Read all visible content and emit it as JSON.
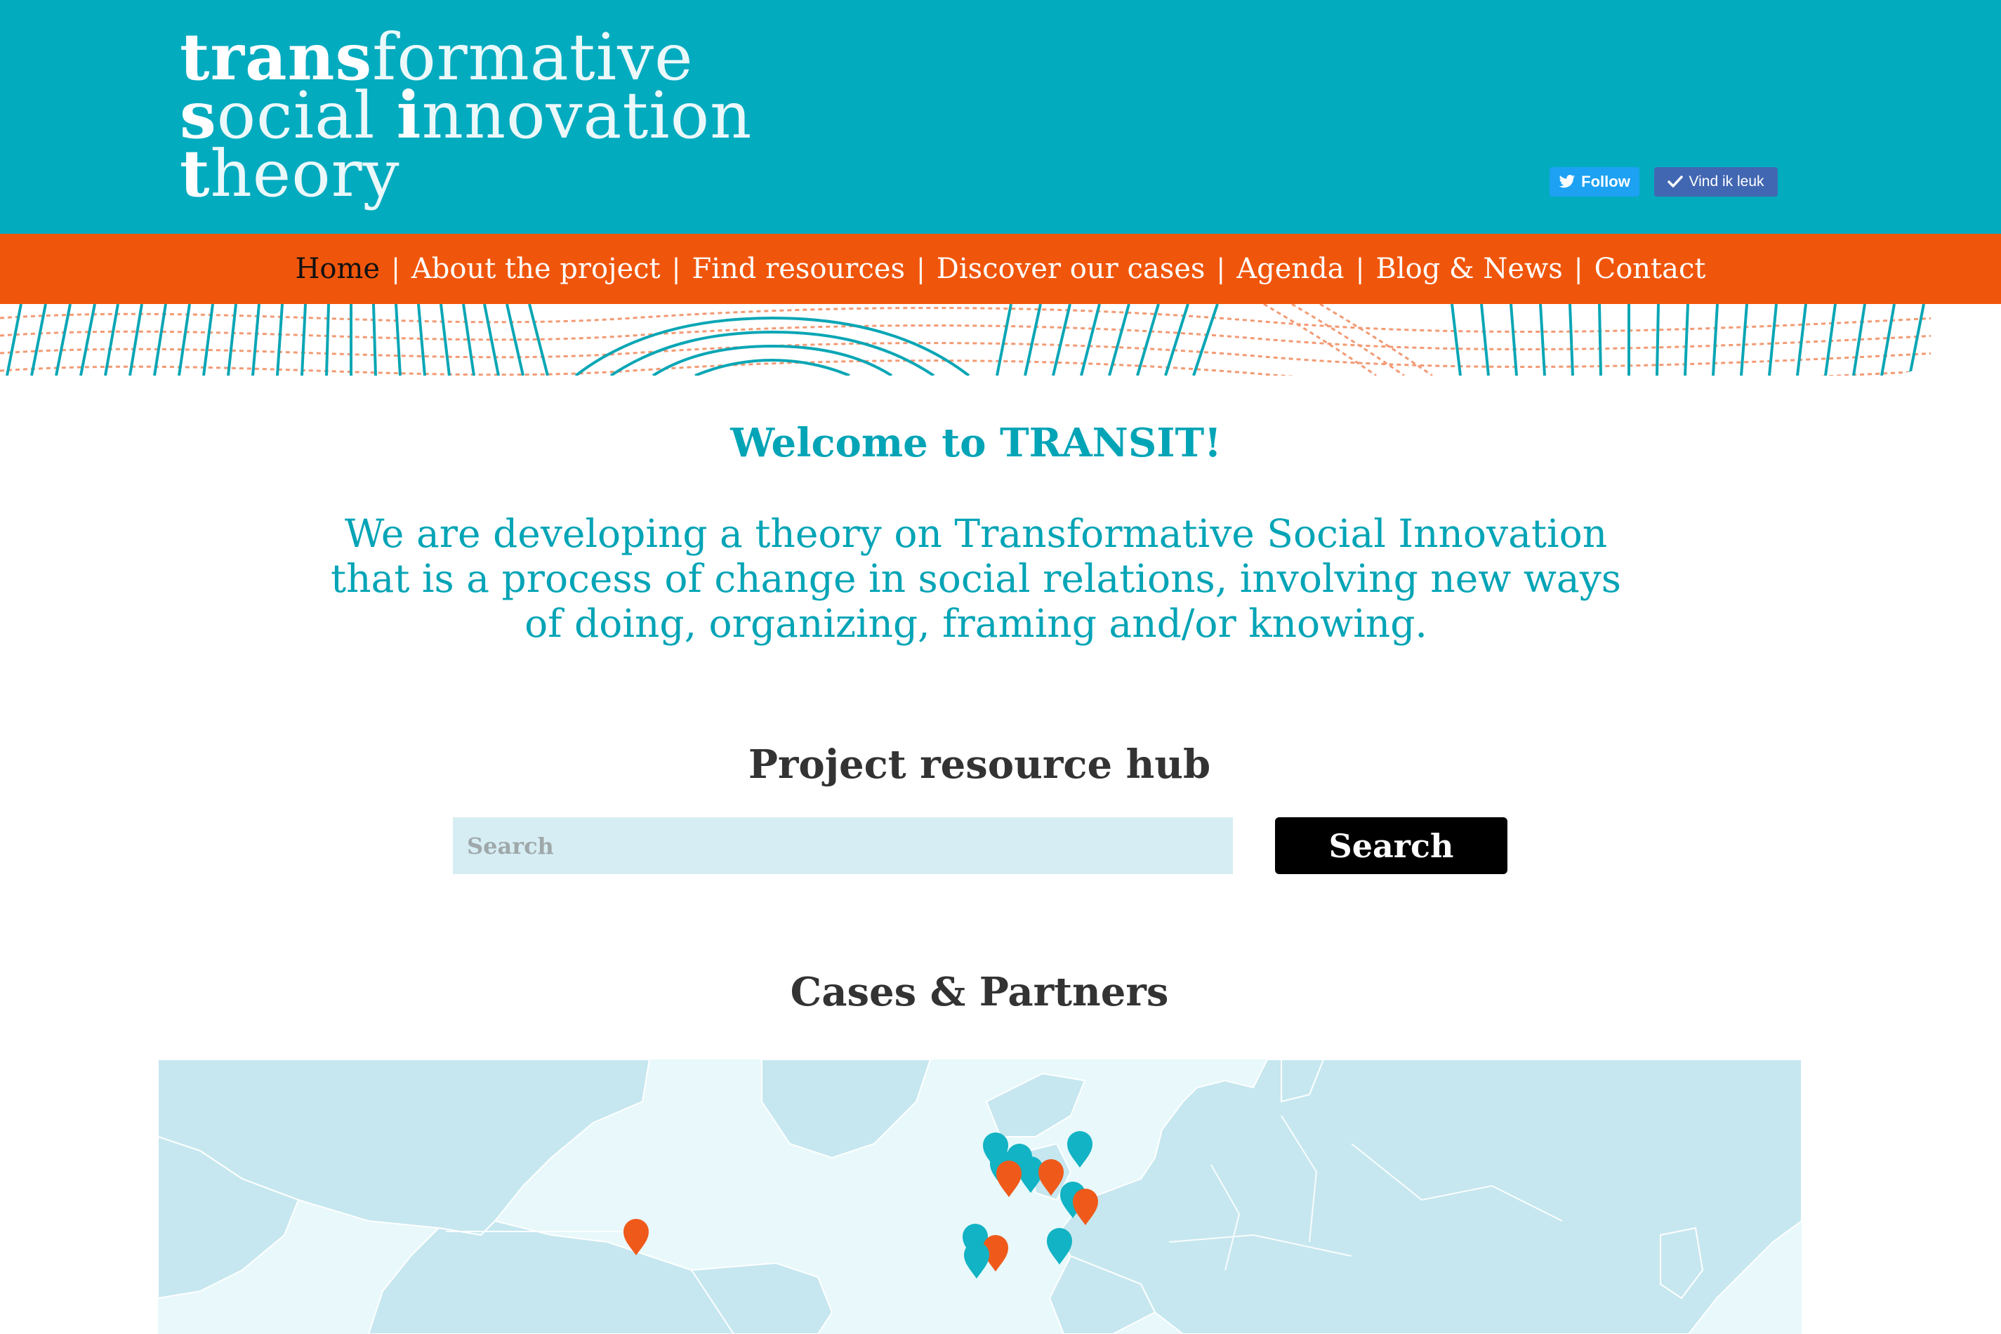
{
  "logo": {
    "line1_bold": "trans",
    "line1_rest": "formative",
    "line2_bold": "s",
    "line2_mid": "ocial ",
    "line2_bold2": "i",
    "line2_rest": "nnovation",
    "line3_bold": "t",
    "line3_rest": "heory"
  },
  "social": {
    "twitter_label": "Follow",
    "facebook_label": "Vind ik leuk",
    "twitter_icon": "twitter-bird-icon",
    "facebook_icon": "checkmark-icon"
  },
  "nav": {
    "items": [
      {
        "label": "Home",
        "active": true
      },
      {
        "label": "About the project",
        "active": false
      },
      {
        "label": "Find resources",
        "active": false
      },
      {
        "label": "Discover our cases",
        "active": false
      },
      {
        "label": "Agenda",
        "active": false
      },
      {
        "label": "Blog & News",
        "active": false
      },
      {
        "label": "Contact",
        "active": false
      }
    ],
    "separator": "|"
  },
  "main": {
    "welcome_title": "Welcome to TRANSIT!",
    "intro": "We are developing a theory on Transformative Social Innovation that is a process of change in social relations, involving new ways of doing, organizing, framing and/or knowing.",
    "hub_title": "Project resource hub",
    "search_placeholder": "Search",
    "search_button": "Search",
    "cases_title": "Cases & Partners"
  },
  "map": {
    "marker_count_cases": 10,
    "marker_count_partners": 7
  },
  "colors": {
    "header_teal": "#03abbf",
    "nav_orange": "#f0560b",
    "accent_text_teal": "#03a4b6",
    "marker_teal": "#11b3c4",
    "marker_orange": "#ef5a1a",
    "map_land": "#c6e7ef",
    "map_water": "#e8f8fb"
  }
}
